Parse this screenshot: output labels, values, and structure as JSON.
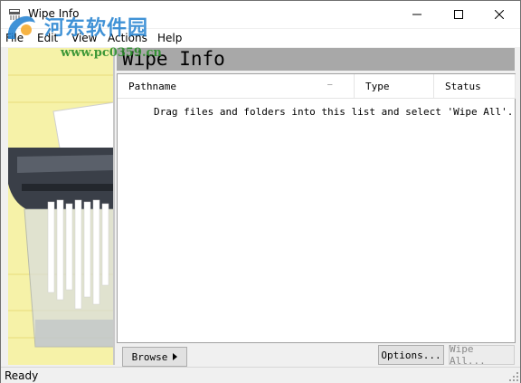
{
  "window": {
    "title": "Wipe Info",
    "controls": {
      "minimize": "minimize",
      "maximize": "maximize",
      "close": "close"
    }
  },
  "watermark": {
    "text": "河东软件园",
    "url": "www.pc0359.cn"
  },
  "menu": {
    "items": [
      {
        "label": "File"
      },
      {
        "label": "Edit"
      },
      {
        "label": "View"
      },
      {
        "label": "Actions"
      },
      {
        "label": "Help"
      }
    ]
  },
  "banner": {
    "title": "Wipe Info"
  },
  "list": {
    "columns": [
      {
        "label": "Pathname"
      },
      {
        "label": "Type"
      },
      {
        "label": "Status"
      }
    ],
    "empty_hint": "Drag files and folders into this list and select 'Wipe All'."
  },
  "buttons": {
    "browse": "Browse",
    "options": "Options...",
    "wipe_all": "Wipe All..."
  },
  "status": {
    "text": "Ready"
  },
  "colors": {
    "artwork_bg": "#f6f2a8",
    "banner_bg": "#a8a8a8",
    "watermark_blue": "#1f7fd0",
    "watermark_green": "#2a8e2a"
  }
}
